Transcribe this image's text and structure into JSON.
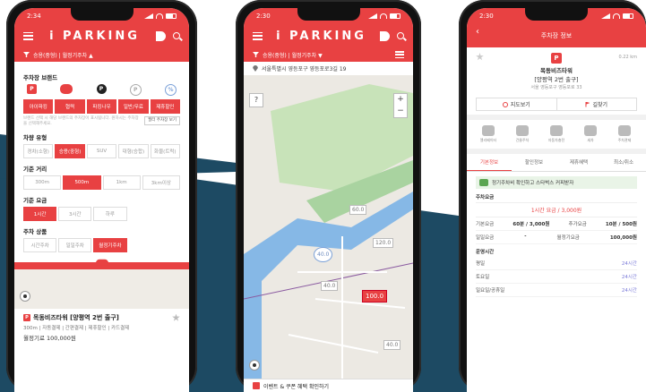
{
  "phone1": {
    "status_time": "2:34",
    "app_logo": "i PARKING",
    "filter_label": "승용(중형) | 월정기주차 ▲",
    "brand_title": "주차장 브랜드",
    "brand_buttons": [
      "아이파킹",
      "협력",
      "파킹나우",
      "일반/무료",
      "제휴할인"
    ],
    "brand_note": "브랜드 선택 시 해당 브랜드의 주차장이 표시됩니다. 원하시는 주차장을 선택해주세요.",
    "brand_note_button": "필터 주차장 보기",
    "vehicle_title": "차량 유형",
    "vehicle_buttons": [
      "경차(소형)",
      "승용(중형)",
      "SUV",
      "대형(승합)",
      "화물(트럭)"
    ],
    "distance_title": "기준 거리",
    "distance_buttons": [
      "300m",
      "500m",
      "1km",
      "3km이상"
    ],
    "fee_title": "기준 요금",
    "fee_buttons": [
      "1시간",
      "3시간",
      "하루"
    ],
    "product_title": "주차 상품",
    "product_buttons": [
      "시간주차",
      "일일주차",
      "월정기주차"
    ],
    "card_title": "목동비즈타워 [양평역 2번 출구]",
    "card_sub": "300m | 자동결제 | 간편결제 | 제휴할인 | 카드결제",
    "card_price": "월정기료 100,000원"
  },
  "phone2": {
    "status_time": "2:30",
    "app_logo": "i PARKING",
    "filter_label": "승용(중형) | 월정기주차 ▼",
    "address": "서울특별시 영등포구 영등포로3길 19",
    "markers": [
      "60.0",
      "120.0",
      "40.0",
      "40.0",
      "100.0",
      "40.0"
    ],
    "banner": "이벤트 & 쿠폰 혜택 확인하기"
  },
  "phone3": {
    "status_time": "2:30",
    "header_title": "주차장 정보",
    "distance": "0.22 km",
    "name": "목동비즈타워",
    "name_sub": "[양평역 2번 출구]",
    "address": "서울 영등포구 영등포로 33",
    "action_1": "지도보기",
    "action_2": "길찾기",
    "amenities": [
      "엘리베이터",
      "건물주차",
      "자동차충전",
      "세차",
      "주차관제"
    ],
    "tabs": [
      "기본정보",
      "할인정보",
      "제휴혜택",
      "최소/취소"
    ],
    "promo": "정기주차비 확인하고 스타벅스 커피받자",
    "fee_header": "주차요금",
    "fee_main": "1시간 요금 / 3,000원",
    "fee_rows": [
      {
        "label": "기본요금",
        "value": "60분 / 3,000원",
        "label2": "추가요금",
        "value2": "10분 / 500원"
      },
      {
        "label": "일일요금",
        "value": "-",
        "label2": "월정기요금",
        "value2": "100,000원"
      }
    ],
    "hours_header": "운영시간",
    "hours_rows": [
      {
        "label": "평일",
        "value": "24시간"
      },
      {
        "label": "토요일",
        "value": "24시간"
      },
      {
        "label": "일요일/공휴일",
        "value": "24시간"
      }
    ]
  }
}
